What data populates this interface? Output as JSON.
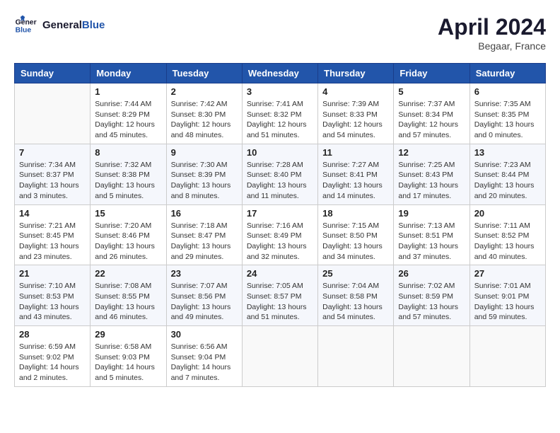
{
  "header": {
    "logo_line1": "General",
    "logo_line2": "Blue",
    "month": "April 2024",
    "location": "Begaar, France"
  },
  "columns": [
    "Sunday",
    "Monday",
    "Tuesday",
    "Wednesday",
    "Thursday",
    "Friday",
    "Saturday"
  ],
  "weeks": [
    [
      {
        "day": "",
        "sunrise": "",
        "sunset": "",
        "daylight": ""
      },
      {
        "day": "1",
        "sunrise": "Sunrise: 7:44 AM",
        "sunset": "Sunset: 8:29 PM",
        "daylight": "Daylight: 12 hours and 45 minutes."
      },
      {
        "day": "2",
        "sunrise": "Sunrise: 7:42 AM",
        "sunset": "Sunset: 8:30 PM",
        "daylight": "Daylight: 12 hours and 48 minutes."
      },
      {
        "day": "3",
        "sunrise": "Sunrise: 7:41 AM",
        "sunset": "Sunset: 8:32 PM",
        "daylight": "Daylight: 12 hours and 51 minutes."
      },
      {
        "day": "4",
        "sunrise": "Sunrise: 7:39 AM",
        "sunset": "Sunset: 8:33 PM",
        "daylight": "Daylight: 12 hours and 54 minutes."
      },
      {
        "day": "5",
        "sunrise": "Sunrise: 7:37 AM",
        "sunset": "Sunset: 8:34 PM",
        "daylight": "Daylight: 12 hours and 57 minutes."
      },
      {
        "day": "6",
        "sunrise": "Sunrise: 7:35 AM",
        "sunset": "Sunset: 8:35 PM",
        "daylight": "Daylight: 13 hours and 0 minutes."
      }
    ],
    [
      {
        "day": "7",
        "sunrise": "Sunrise: 7:34 AM",
        "sunset": "Sunset: 8:37 PM",
        "daylight": "Daylight: 13 hours and 3 minutes."
      },
      {
        "day": "8",
        "sunrise": "Sunrise: 7:32 AM",
        "sunset": "Sunset: 8:38 PM",
        "daylight": "Daylight: 13 hours and 5 minutes."
      },
      {
        "day": "9",
        "sunrise": "Sunrise: 7:30 AM",
        "sunset": "Sunset: 8:39 PM",
        "daylight": "Daylight: 13 hours and 8 minutes."
      },
      {
        "day": "10",
        "sunrise": "Sunrise: 7:28 AM",
        "sunset": "Sunset: 8:40 PM",
        "daylight": "Daylight: 13 hours and 11 minutes."
      },
      {
        "day": "11",
        "sunrise": "Sunrise: 7:27 AM",
        "sunset": "Sunset: 8:41 PM",
        "daylight": "Daylight: 13 hours and 14 minutes."
      },
      {
        "day": "12",
        "sunrise": "Sunrise: 7:25 AM",
        "sunset": "Sunset: 8:43 PM",
        "daylight": "Daylight: 13 hours and 17 minutes."
      },
      {
        "day": "13",
        "sunrise": "Sunrise: 7:23 AM",
        "sunset": "Sunset: 8:44 PM",
        "daylight": "Daylight: 13 hours and 20 minutes."
      }
    ],
    [
      {
        "day": "14",
        "sunrise": "Sunrise: 7:21 AM",
        "sunset": "Sunset: 8:45 PM",
        "daylight": "Daylight: 13 hours and 23 minutes."
      },
      {
        "day": "15",
        "sunrise": "Sunrise: 7:20 AM",
        "sunset": "Sunset: 8:46 PM",
        "daylight": "Daylight: 13 hours and 26 minutes."
      },
      {
        "day": "16",
        "sunrise": "Sunrise: 7:18 AM",
        "sunset": "Sunset: 8:47 PM",
        "daylight": "Daylight: 13 hours and 29 minutes."
      },
      {
        "day": "17",
        "sunrise": "Sunrise: 7:16 AM",
        "sunset": "Sunset: 8:49 PM",
        "daylight": "Daylight: 13 hours and 32 minutes."
      },
      {
        "day": "18",
        "sunrise": "Sunrise: 7:15 AM",
        "sunset": "Sunset: 8:50 PM",
        "daylight": "Daylight: 13 hours and 34 minutes."
      },
      {
        "day": "19",
        "sunrise": "Sunrise: 7:13 AM",
        "sunset": "Sunset: 8:51 PM",
        "daylight": "Daylight: 13 hours and 37 minutes."
      },
      {
        "day": "20",
        "sunrise": "Sunrise: 7:11 AM",
        "sunset": "Sunset: 8:52 PM",
        "daylight": "Daylight: 13 hours and 40 minutes."
      }
    ],
    [
      {
        "day": "21",
        "sunrise": "Sunrise: 7:10 AM",
        "sunset": "Sunset: 8:53 PM",
        "daylight": "Daylight: 13 hours and 43 minutes."
      },
      {
        "day": "22",
        "sunrise": "Sunrise: 7:08 AM",
        "sunset": "Sunset: 8:55 PM",
        "daylight": "Daylight: 13 hours and 46 minutes."
      },
      {
        "day": "23",
        "sunrise": "Sunrise: 7:07 AM",
        "sunset": "Sunset: 8:56 PM",
        "daylight": "Daylight: 13 hours and 49 minutes."
      },
      {
        "day": "24",
        "sunrise": "Sunrise: 7:05 AM",
        "sunset": "Sunset: 8:57 PM",
        "daylight": "Daylight: 13 hours and 51 minutes."
      },
      {
        "day": "25",
        "sunrise": "Sunrise: 7:04 AM",
        "sunset": "Sunset: 8:58 PM",
        "daylight": "Daylight: 13 hours and 54 minutes."
      },
      {
        "day": "26",
        "sunrise": "Sunrise: 7:02 AM",
        "sunset": "Sunset: 8:59 PM",
        "daylight": "Daylight: 13 hours and 57 minutes."
      },
      {
        "day": "27",
        "sunrise": "Sunrise: 7:01 AM",
        "sunset": "Sunset: 9:01 PM",
        "daylight": "Daylight: 13 hours and 59 minutes."
      }
    ],
    [
      {
        "day": "28",
        "sunrise": "Sunrise: 6:59 AM",
        "sunset": "Sunset: 9:02 PM",
        "daylight": "Daylight: 14 hours and 2 minutes."
      },
      {
        "day": "29",
        "sunrise": "Sunrise: 6:58 AM",
        "sunset": "Sunset: 9:03 PM",
        "daylight": "Daylight: 14 hours and 5 minutes."
      },
      {
        "day": "30",
        "sunrise": "Sunrise: 6:56 AM",
        "sunset": "Sunset: 9:04 PM",
        "daylight": "Daylight: 14 hours and 7 minutes."
      },
      {
        "day": "",
        "sunrise": "",
        "sunset": "",
        "daylight": ""
      },
      {
        "day": "",
        "sunrise": "",
        "sunset": "",
        "daylight": ""
      },
      {
        "day": "",
        "sunrise": "",
        "sunset": "",
        "daylight": ""
      },
      {
        "day": "",
        "sunrise": "",
        "sunset": "",
        "daylight": ""
      }
    ]
  ]
}
